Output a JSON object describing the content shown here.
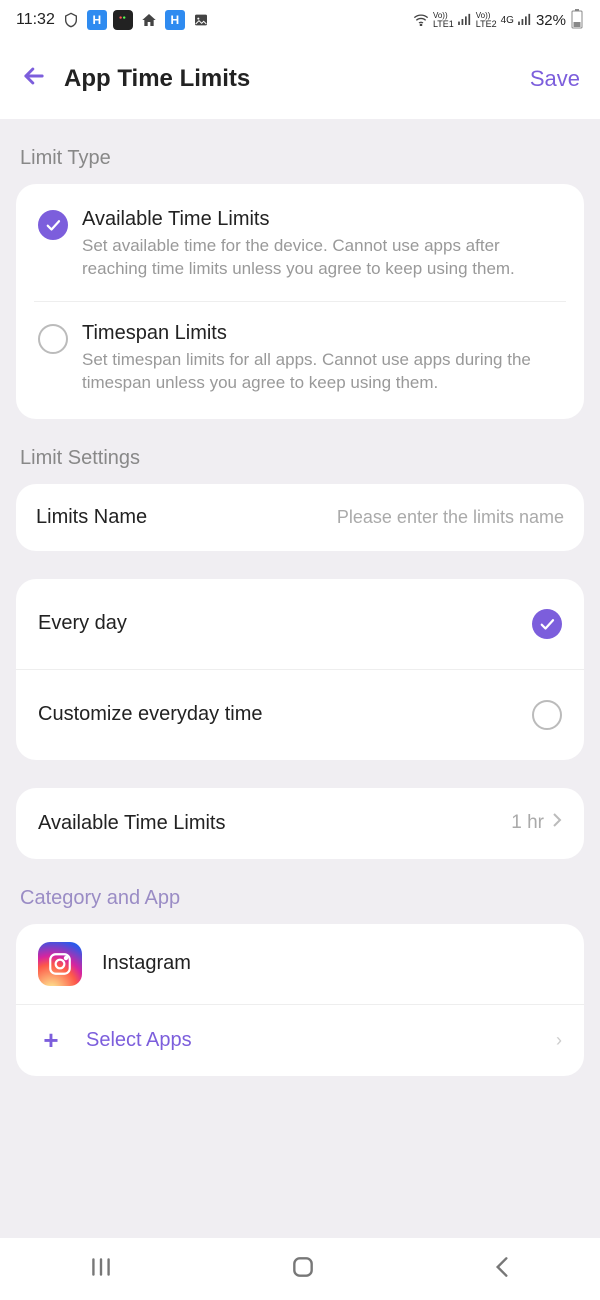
{
  "status": {
    "time": "11:32",
    "network": "LTE1",
    "network2": "LTE2",
    "signal": "4G",
    "battery": "32%"
  },
  "header": {
    "title": "App Time Limits",
    "save": "Save"
  },
  "sections": {
    "limit_type": "Limit Type",
    "limit_settings": "Limit Settings",
    "category": "Category and App"
  },
  "limit_types": {
    "available": {
      "title": "Available Time Limits",
      "desc": "Set available time for the device. Cannot use apps after reaching time limits unless you agree to keep using them.",
      "selected": true
    },
    "timespan": {
      "title": "Timespan Limits",
      "desc": "Set timespan limits for all apps. Cannot use apps during the timespan unless you agree to keep using them.",
      "selected": false
    }
  },
  "settings": {
    "name_label": "Limits Name",
    "name_placeholder": "Please enter the limits name",
    "name_value": ""
  },
  "schedule": {
    "every_day": {
      "label": "Every day",
      "selected": true
    },
    "customize": {
      "label": "Customize everyday time",
      "selected": false
    }
  },
  "time_limit": {
    "label": "Available Time Limits",
    "value": "1 hr"
  },
  "apps": {
    "item": {
      "name": "Instagram"
    },
    "select_label": "Select Apps"
  }
}
